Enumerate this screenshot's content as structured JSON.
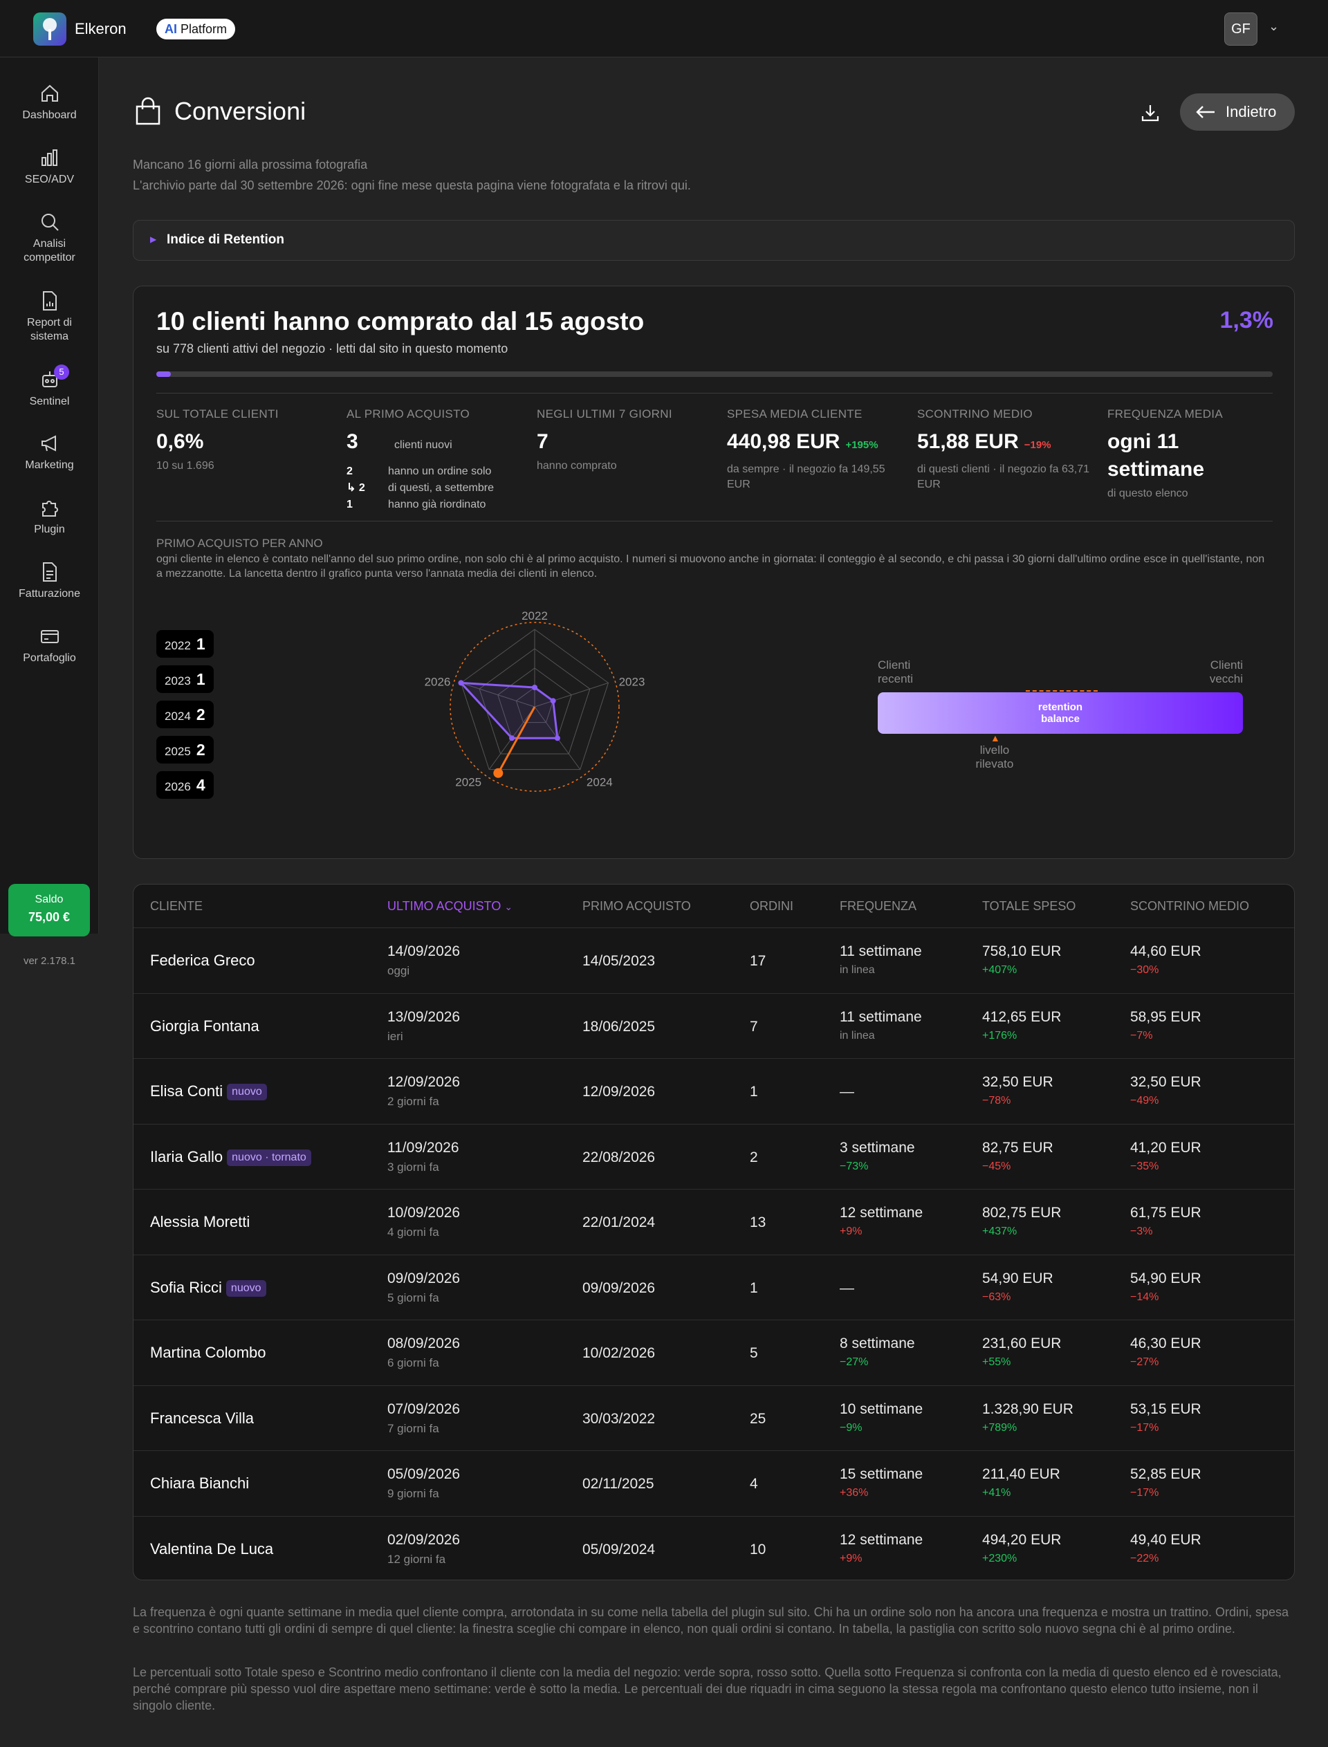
{
  "header": {
    "brand": "Elkeron",
    "ai_label": "AI",
    "platform_label": "Platform",
    "avatar": "GF"
  },
  "nav": [
    {
      "label": "Dashboard",
      "icon": "home-icon"
    },
    {
      "label": "SEO/ADV",
      "icon": "bar-chart-icon"
    },
    {
      "label": "Analisi competitor",
      "icon": "search-icon"
    },
    {
      "label": "Report di sistema",
      "icon": "report-icon"
    },
    {
      "label": "Sentinel",
      "icon": "robot-icon",
      "badge": "5"
    },
    {
      "label": "Marketing",
      "icon": "megaphone-icon"
    },
    {
      "label": "Plugin",
      "icon": "puzzle-icon"
    },
    {
      "label": "Fatturazione",
      "icon": "invoice-icon"
    },
    {
      "label": "Portafoglio",
      "icon": "wallet-icon"
    }
  ],
  "saldo": {
    "label": "Saldo",
    "value": "75,00 €"
  },
  "version": "ver 2.178.1",
  "page": {
    "title": "Conversioni",
    "back": "Indietro",
    "info1": "Mancano 16 giorni alla prossima fotografia",
    "info2": "L'archivio parte dal 30 settembre 2026: ogni fine mese questa pagina viene fotografata e la ritrovi qui.",
    "retention_toggle": "Indice di Retention"
  },
  "summary": {
    "headline": "10 clienti hanno comprato dal 15 agosto",
    "subline": "su 778 clienti attivi del negozio · letti dal sito in questo momento",
    "percent": "1,3%",
    "progress": 0.013,
    "stats": {
      "totale": {
        "label": "SUL TOTALE CLIENTI",
        "value": "0,6%",
        "note": "10 su 1.696"
      },
      "primo": {
        "label": "AL PRIMO ACQUISTO",
        "value": "3",
        "value_note": "clienti nuovi",
        "rows": [
          {
            "n": "2",
            "t": "hanno un ordine solo"
          },
          {
            "n": "↳ 2",
            "t": "di questi, a settembre"
          },
          {
            "n": "1",
            "t": "hanno già riordinato"
          }
        ]
      },
      "ultimi7": {
        "label": "NEGLI ULTIMI 7 GIORNI",
        "value": "7",
        "note": "hanno comprato"
      },
      "spesa": {
        "label": "SPESA MEDIA CLIENTE",
        "value": "440,98 EUR",
        "delta": "+195%",
        "note": "da sempre · il negozio fa 149,55 EUR"
      },
      "scontrino": {
        "label": "SCONTRINO MEDIO",
        "value": "51,88 EUR",
        "delta": "−19%",
        "note": "di questi clienti · il negozio fa 63,71 EUR"
      },
      "frequenza": {
        "label": "FREQUENZA MEDIA",
        "value": "ogni 11 settimane",
        "note": "di questo elenco"
      }
    }
  },
  "by_year": {
    "title": "PRIMO ACQUISTO PER ANNO",
    "desc": "ogni cliente in elenco è contato nell'anno del suo primo ordine, non solo chi è al primo acquisto. I numeri si muovono anche in giornata: il conteggio è al secondo, e chi passa i 30 giorni dall'ultimo ordine esce in quell'istante, non a mezzanotte. La lancetta dentro il grafico punta verso l'annata media dei clienti in elenco.",
    "years": [
      {
        "year": "2022",
        "count": 1
      },
      {
        "year": "2023",
        "count": 1
      },
      {
        "year": "2024",
        "count": 2
      },
      {
        "year": "2025",
        "count": 2
      },
      {
        "year": "2026",
        "count": 4
      }
    ],
    "radar_max": 4
  },
  "balance": {
    "left": "Clienti recenti",
    "right": "Clienti vecchi",
    "bar": "retention balance",
    "marker": "livello rilevato",
    "level": 0.32
  },
  "table": {
    "headers": [
      "CLIENTE",
      "ULTIMO ACQUISTO",
      "PRIMO ACQUISTO",
      "ORDINI",
      "FREQUENZA",
      "TOTALE SPESO",
      "SCONTRINO MEDIO"
    ],
    "rows": [
      {
        "name": "Federica Greco",
        "tag": "",
        "last": "14/09/2026",
        "ago": "oggi",
        "first": "14/05/2023",
        "orders": "17",
        "freq": "11 settimane",
        "freq_note": "in linea",
        "freq_cls": "muted",
        "tot": "758,10 EUR",
        "tot_d": "+407%",
        "tot_cls": "pos",
        "sc": "44,60 EUR",
        "sc_d": "−30%",
        "sc_cls": "neg"
      },
      {
        "name": "Giorgia Fontana",
        "tag": "",
        "last": "13/09/2026",
        "ago": "ieri",
        "first": "18/06/2025",
        "orders": "7",
        "freq": "11 settimane",
        "freq_note": "in linea",
        "freq_cls": "muted",
        "tot": "412,65 EUR",
        "tot_d": "+176%",
        "tot_cls": "pos",
        "sc": "58,95 EUR",
        "sc_d": "−7%",
        "sc_cls": "neg"
      },
      {
        "name": "Elisa Conti",
        "tag": "nuovo",
        "last": "12/09/2026",
        "ago": "2 giorni fa",
        "first": "12/09/2026",
        "orders": "1",
        "freq": "—",
        "freq_note": "",
        "freq_cls": "muted",
        "tot": "32,50 EUR",
        "tot_d": "−78%",
        "tot_cls": "neg",
        "sc": "32,50 EUR",
        "sc_d": "−49%",
        "sc_cls": "neg"
      },
      {
        "name": "Ilaria Gallo",
        "tag": "nuovo · tornato",
        "last": "11/09/2026",
        "ago": "3 giorni fa",
        "first": "22/08/2026",
        "orders": "2",
        "freq": "3 settimane",
        "freq_note": "−73%",
        "freq_cls": "pos",
        "tot": "82,75 EUR",
        "tot_d": "−45%",
        "tot_cls": "neg",
        "sc": "41,20 EUR",
        "sc_d": "−35%",
        "sc_cls": "neg"
      },
      {
        "name": "Alessia Moretti",
        "tag": "",
        "last": "10/09/2026",
        "ago": "4 giorni fa",
        "first": "22/01/2024",
        "orders": "13",
        "freq": "12 settimane",
        "freq_note": "+9%",
        "freq_cls": "neg",
        "tot": "802,75 EUR",
        "tot_d": "+437%",
        "tot_cls": "pos",
        "sc": "61,75 EUR",
        "sc_d": "−3%",
        "sc_cls": "neg"
      },
      {
        "name": "Sofia Ricci",
        "tag": "nuovo",
        "last": "09/09/2026",
        "ago": "5 giorni fa",
        "first": "09/09/2026",
        "orders": "1",
        "freq": "—",
        "freq_note": "",
        "freq_cls": "muted",
        "tot": "54,90 EUR",
        "tot_d": "−63%",
        "tot_cls": "neg",
        "sc": "54,90 EUR",
        "sc_d": "−14%",
        "sc_cls": "neg"
      },
      {
        "name": "Martina Colombo",
        "tag": "",
        "last": "08/09/2026",
        "ago": "6 giorni fa",
        "first": "10/02/2026",
        "orders": "5",
        "freq": "8 settimane",
        "freq_note": "−27%",
        "freq_cls": "pos",
        "tot": "231,60 EUR",
        "tot_d": "+55%",
        "tot_cls": "pos",
        "sc": "46,30 EUR",
        "sc_d": "−27%",
        "sc_cls": "neg"
      },
      {
        "name": "Francesca Villa",
        "tag": "",
        "last": "07/09/2026",
        "ago": "7 giorni fa",
        "first": "30/03/2022",
        "orders": "25",
        "freq": "10 settimane",
        "freq_note": "−9%",
        "freq_cls": "pos",
        "tot": "1.328,90 EUR",
        "tot_d": "+789%",
        "tot_cls": "pos",
        "sc": "53,15 EUR",
        "sc_d": "−17%",
        "sc_cls": "neg"
      },
      {
        "name": "Chiara Bianchi",
        "tag": "",
        "last": "05/09/2026",
        "ago": "9 giorni fa",
        "first": "02/11/2025",
        "orders": "4",
        "freq": "15 settimane",
        "freq_note": "+36%",
        "freq_cls": "neg",
        "tot": "211,40 EUR",
        "tot_d": "+41%",
        "tot_cls": "pos",
        "sc": "52,85 EUR",
        "sc_d": "−17%",
        "sc_cls": "neg"
      },
      {
        "name": "Valentina De Luca",
        "tag": "",
        "last": "02/09/2026",
        "ago": "12 giorni fa",
        "first": "05/09/2024",
        "orders": "10",
        "freq": "12 settimane",
        "freq_note": "+9%",
        "freq_cls": "neg",
        "tot": "494,20 EUR",
        "tot_d": "+230%",
        "tot_cls": "pos",
        "sc": "49,40 EUR",
        "sc_d": "−22%",
        "sc_cls": "neg"
      }
    ]
  },
  "footer": {
    "p1": "La frequenza è ogni quante settimane in media quel cliente compra, arrotondata in su come nella tabella del plugin sul sito. Chi ha un ordine solo non ha ancora una frequenza e mostra un trattino. Ordini, spesa e scontrino contano tutti gli ordini di sempre di quel cliente: la finestra sceglie chi compare in elenco, non quali ordini si contano. In tabella, la pastiglia con scritto solo nuovo segna chi è al primo ordine.",
    "p2": "Le percentuali sotto Totale speso e Scontrino medio confrontano il cliente con la media del negozio: verde sopra, rosso sotto. Quella sotto Frequenza si confronta con la media di questo elenco ed è rovesciata, perché comprare più spesso vuol dire aspettare meno settimane: verde è sotto la media. Le percentuali dei due riquadri in cima seguono la stessa regola ma confrontano questo elenco tutto insieme, non il singolo cliente."
  },
  "colors": {
    "accent": "#8b5cf6",
    "positive": "#22c55e",
    "negative": "#ef4444",
    "needle": "#f97316"
  }
}
